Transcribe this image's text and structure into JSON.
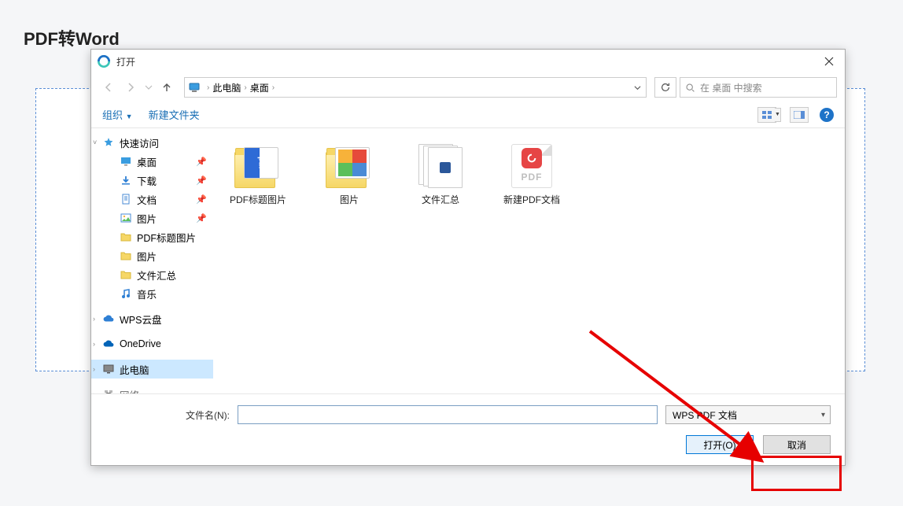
{
  "page": {
    "title": "PDF转Word"
  },
  "dialog": {
    "title": "打开",
    "breadcrumb": {
      "root": "此电脑",
      "current": "桌面"
    },
    "search_placeholder": "在 桌面 中搜索",
    "toolbar": {
      "organize": "组织",
      "new_folder": "新建文件夹"
    },
    "sidebar": {
      "quick_access": "快速访问",
      "desktop": "桌面",
      "downloads": "下载",
      "documents": "文档",
      "pictures": "图片",
      "folder_pdf": "PDF标题图片",
      "folder_pics": "图片",
      "folder_files": "文件汇总",
      "music": "音乐",
      "wps_cloud": "WPS云盘",
      "onedrive": "OneDrive",
      "this_pc": "此电脑",
      "network": "网络"
    },
    "files": [
      {
        "name": "PDF标题图片"
      },
      {
        "name": "图片"
      },
      {
        "name": "文件汇总"
      },
      {
        "name": "新建PDF文档"
      }
    ],
    "footer": {
      "filename_label": "文件名(N):",
      "filetype": "WPS PDF 文档",
      "open": "打开(O)",
      "cancel": "取消"
    }
  }
}
